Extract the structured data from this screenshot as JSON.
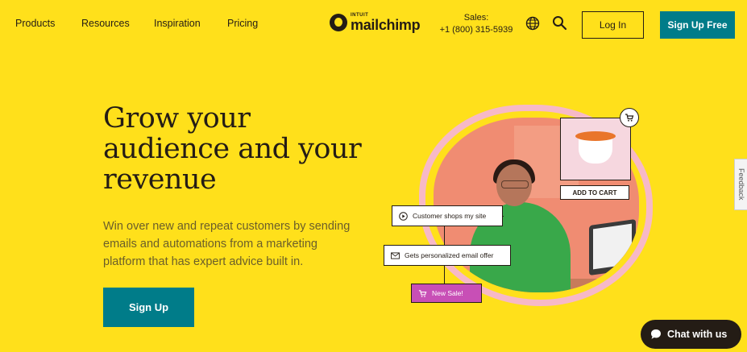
{
  "nav": {
    "links": [
      "Products",
      "Resources",
      "Inspiration",
      "Pricing"
    ],
    "logo": {
      "brand": "INTUIT",
      "name": "mailchimp"
    },
    "sales": {
      "label": "Sales:",
      "phone": "+1 (800) 315-5939"
    },
    "login_label": "Log In",
    "signup_free_label": "Sign Up Free",
    "icons": [
      "globe-icon",
      "search-icon"
    ]
  },
  "hero": {
    "headline_lines": [
      "Grow your",
      "audience and your",
      "revenue"
    ],
    "subtext_lines": [
      "Win over new and repeat customers by sending",
      "emails and automations from a marketing",
      "platform that has expert advice built in."
    ],
    "signup_label": "Sign Up"
  },
  "illustration": {
    "add_to_cart": "ADD TO CART",
    "chip_shops": "Customer shops my site",
    "chip_email": "Gets personalized email offer",
    "chip_sale": "New Sale!"
  },
  "feedback_label": "Feedback",
  "chat_label": "Chat with us",
  "colors": {
    "background": "#ffe01b",
    "accent": "#007c89",
    "text": "#241c15",
    "sale_chip": "#c84fb6"
  }
}
